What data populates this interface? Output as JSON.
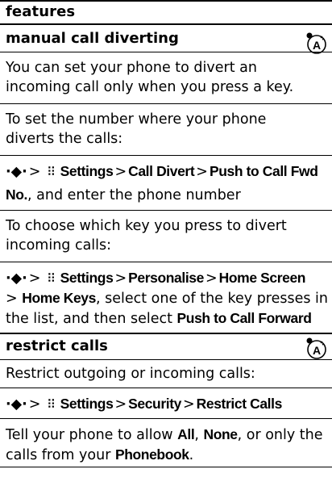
{
  "header": {
    "title": "features"
  },
  "sections": [
    {
      "title": "manual call diverting",
      "icon": "network-feature-icon",
      "p1": [
        "You can set your phone to divert an",
        "incoming call only when you press a key."
      ],
      "p2": [
        "To set the number where your phone",
        "diverts the calls:"
      ],
      "path1": {
        "nav": "·◆·",
        "gt": ">",
        "menu_glyph": "⠿",
        "settings": "Settings",
        "call_divert": "Call Divert",
        "push_fwd": "Push to Call Fwd",
        "no": "No.",
        "tail": ", and enter the phone number"
      },
      "p3": [
        "To choose which key you press to divert",
        "incoming calls:"
      ],
      "path2": {
        "settings": "Settings",
        "personalise": "Personalise",
        "home_screen": "Home Screen",
        "home_keys": "Home Keys",
        "mid": ", select one of the key presses in",
        "line3a": "the list, and then select ",
        "push_forward": "Push to Call Forward"
      }
    },
    {
      "title": "restrict calls",
      "icon": "network-feature-icon",
      "p1": "Restrict outgoing or incoming calls:",
      "path": {
        "settings": "Settings",
        "security": "Security",
        "restrict": "Restrict Calls"
      },
      "p2a": "Tell your phone to allow ",
      "all": "All",
      "comma1": ", ",
      "none": "None",
      "p2b": ", or only the",
      "p2c": "calls from your ",
      "phonebook": "Phonebook",
      "p2d": "."
    }
  ]
}
